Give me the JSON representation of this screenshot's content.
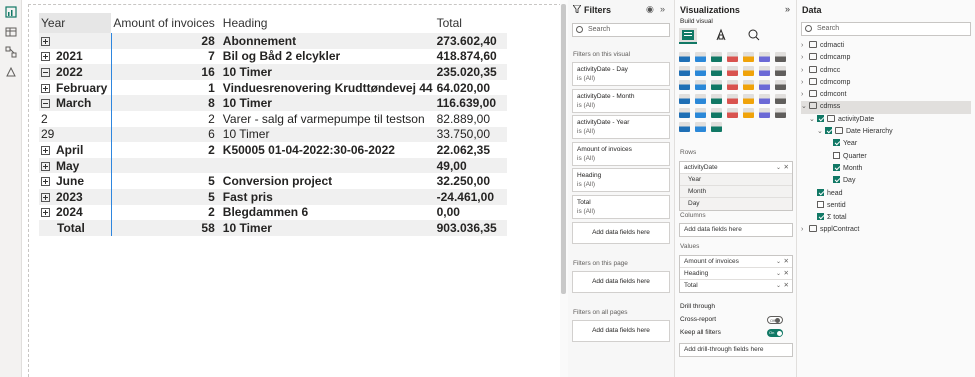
{
  "matrix": {
    "headers": [
      "Year",
      "Amount of invoices",
      "Heading",
      "Total"
    ],
    "rows": [
      {
        "label": "",
        "amount": "28",
        "heading": "Abonnement",
        "total": "273.602,40",
        "level": 0,
        "expander": "plus",
        "bold": true
      },
      {
        "label": "2021",
        "amount": "7",
        "heading": "Bil og Båd 2 elcykler",
        "total": "418.874,60",
        "level": 0,
        "expander": "plus",
        "bold": true
      },
      {
        "label": "2022",
        "amount": "16",
        "heading": "10 Timer",
        "total": "235.020,35",
        "level": 0,
        "expander": "minus",
        "bold": true
      },
      {
        "label": "February",
        "amount": "1",
        "heading": "Vinduesrenovering Krudttøndevej 44",
        "total": "64.020,00",
        "level": 1,
        "expander": "plus",
        "bold": true
      },
      {
        "label": "March",
        "amount": "8",
        "heading": "10 Timer",
        "total": "116.639,00",
        "level": 1,
        "expander": "minus",
        "bold": true
      },
      {
        "label": "2",
        "amount": "2",
        "heading": "Varer - salg af varmepumpe til testson",
        "total": "82.889,00",
        "level": 2,
        "expander": "",
        "bold": false
      },
      {
        "label": "29",
        "amount": "6",
        "heading": "10 Timer",
        "total": "33.750,00",
        "level": 2,
        "expander": "",
        "bold": false
      },
      {
        "label": "April",
        "amount": "2",
        "heading": "K50005 01-04-2022:30-06-2022",
        "total": "22.062,35",
        "level": 1,
        "expander": "plus",
        "bold": true
      },
      {
        "label": "May",
        "amount": "",
        "heading": "",
        "total": "49,00",
        "level": 1,
        "expander": "plus",
        "bold": true
      },
      {
        "label": "June",
        "amount": "5",
        "heading": "Conversion project",
        "total": "32.250,00",
        "level": 1,
        "expander": "plus",
        "bold": true
      },
      {
        "label": "2023",
        "amount": "5",
        "heading": "Fast pris",
        "total": "-24.461,00",
        "level": 0,
        "expander": "plus",
        "bold": true
      },
      {
        "label": "2024",
        "amount": "2",
        "heading": "Blegdammen 6",
        "total": "0,00",
        "level": 0,
        "expander": "plus",
        "bold": true
      },
      {
        "label": "Total",
        "amount": "58",
        "heading": "10 Timer",
        "total": "903.036,35",
        "level": 0,
        "expander": "",
        "bold": true
      }
    ]
  },
  "filters": {
    "title": "Filters",
    "search_placeholder": "Search",
    "on_visual_label": "Filters on this visual",
    "cards": [
      {
        "name": "activityDate - Day",
        "value": "is (All)"
      },
      {
        "name": "activityDate - Month",
        "value": "is (All)"
      },
      {
        "name": "activityDate - Year",
        "value": "is (All)"
      },
      {
        "name": "Amount of invoices",
        "value": "is (All)"
      },
      {
        "name": "Heading",
        "value": "is (All)"
      },
      {
        "name": "Total",
        "value": "is (All)"
      }
    ],
    "add_fields": "Add data fields here",
    "on_page_label": "Filters on this page",
    "on_all_pages_label": "Filters on all pages"
  },
  "viz": {
    "title": "Visualizations",
    "build_visual": "Build visual",
    "rows_label": "Rows",
    "rows_field": "activityDate",
    "rows_sub": [
      "Year",
      "Month",
      "Day"
    ],
    "columns_label": "Columns",
    "columns_placeholder": "Add data fields here",
    "values_label": "Values",
    "values": [
      "Amount of invoices",
      "Heading",
      "Total"
    ],
    "drill_label": "Drill through",
    "cross_report": "Cross-report",
    "cross_report_state": "Off",
    "keep_filters": "Keep all filters",
    "keep_filters_state": "On",
    "drill_placeholder": "Add drill-through fields here"
  },
  "data": {
    "title": "Data",
    "search_placeholder": "Search",
    "tree": [
      {
        "label": "cdmacti",
        "indent": 0,
        "chev": "›",
        "cb": null,
        "icon": "table-icon"
      },
      {
        "label": "cdmcamp",
        "indent": 0,
        "chev": "›",
        "cb": null,
        "icon": "table-icon"
      },
      {
        "label": "cdmcc",
        "indent": 0,
        "chev": "›",
        "cb": null,
        "icon": "table-icon"
      },
      {
        "label": "cdmcomp",
        "indent": 0,
        "chev": "›",
        "cb": null,
        "icon": "table-icon"
      },
      {
        "label": "cdmcont",
        "indent": 0,
        "chev": "›",
        "cb": null,
        "icon": "table-icon"
      },
      {
        "label": "cdmss",
        "indent": 0,
        "chev": "⌄",
        "cb": null,
        "icon": "table-icon",
        "hl": true
      },
      {
        "label": "activityDate",
        "indent": 1,
        "chev": "⌄",
        "cb": true,
        "icon": "calendar-icon"
      },
      {
        "label": "Date Hierarchy",
        "indent": 2,
        "chev": "⌄",
        "cb": true,
        "icon": "hierarchy-icon"
      },
      {
        "label": "Year",
        "indent": 3,
        "chev": "",
        "cb": true,
        "icon": ""
      },
      {
        "label": "Quarter",
        "indent": 3,
        "chev": "",
        "cb": false,
        "icon": ""
      },
      {
        "label": "Month",
        "indent": 3,
        "chev": "",
        "cb": true,
        "icon": ""
      },
      {
        "label": "Day",
        "indent": 3,
        "chev": "",
        "cb": true,
        "icon": ""
      },
      {
        "label": "head",
        "indent": 1,
        "chev": "",
        "cb": true,
        "icon": ""
      },
      {
        "label": "sentid",
        "indent": 1,
        "chev": "",
        "cb": false,
        "icon": ""
      },
      {
        "label": "Σ total",
        "indent": 1,
        "chev": "",
        "cb": true,
        "icon": ""
      },
      {
        "label": "spplContract",
        "indent": 0,
        "chev": "›",
        "cb": null,
        "icon": "table-icon"
      }
    ]
  },
  "colors": {
    "accent": "#117865",
    "selection": "#2e86de",
    "alt_row": "#f0f0f0"
  }
}
